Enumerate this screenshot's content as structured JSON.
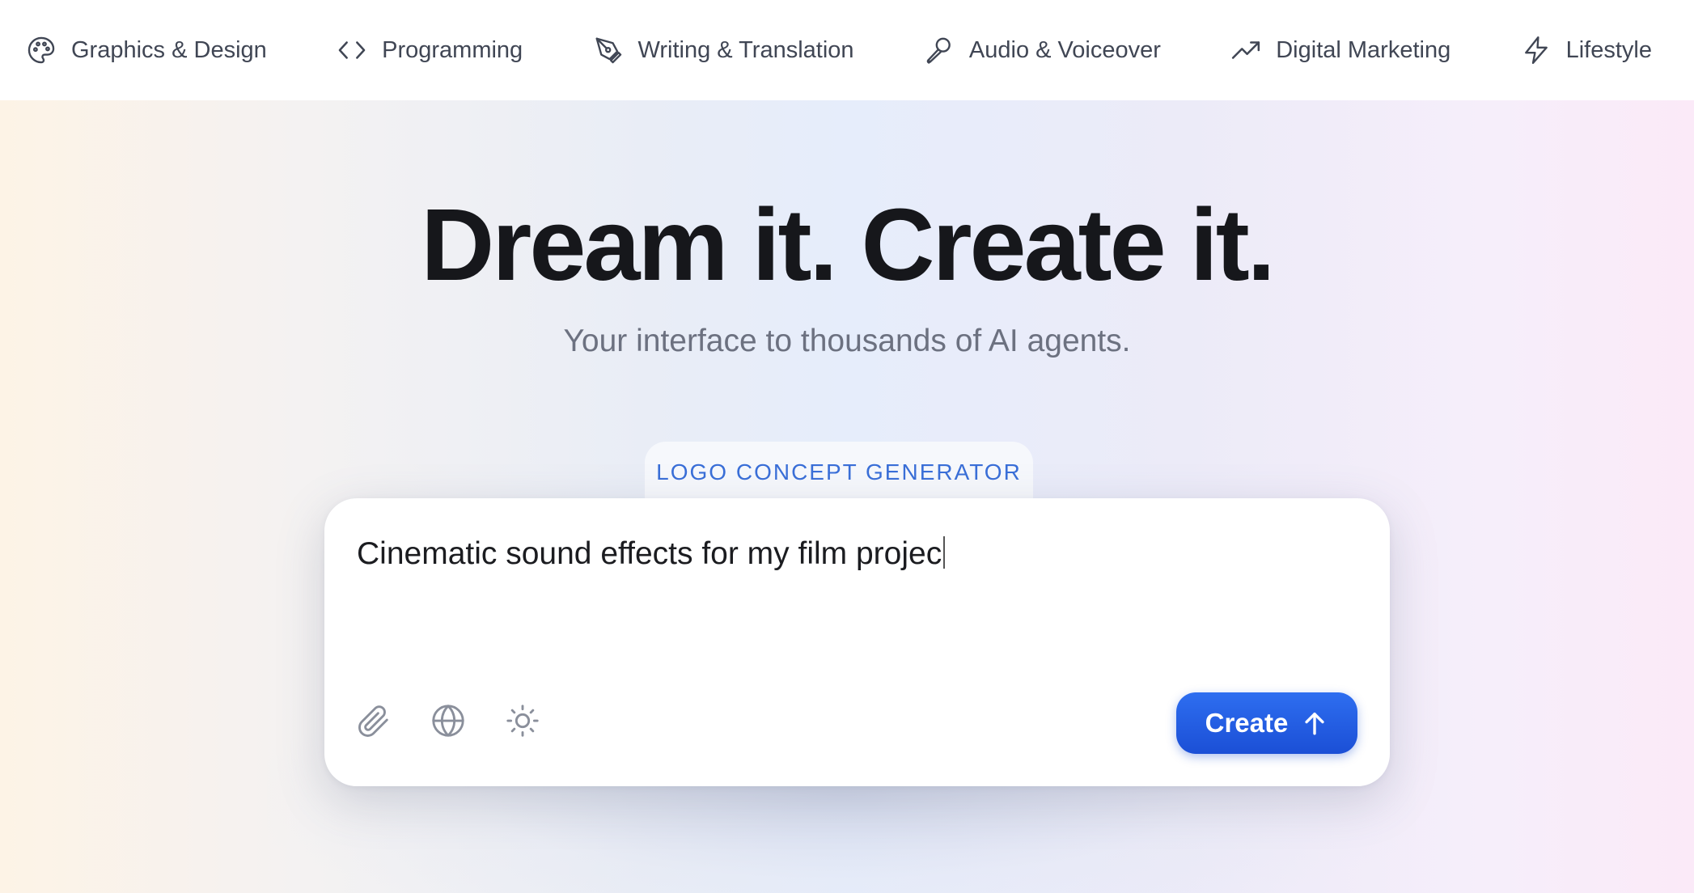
{
  "nav": {
    "categories": [
      {
        "label": "Graphics & Design",
        "icon": "palette-icon"
      },
      {
        "label": "Programming",
        "icon": "code-icon"
      },
      {
        "label": "Writing & Translation",
        "icon": "pen-tool-icon"
      },
      {
        "label": "Audio & Voiceover",
        "icon": "microphone-icon"
      },
      {
        "label": "Digital Marketing",
        "icon": "trending-up-icon"
      },
      {
        "label": "Lifestyle",
        "icon": "lightning-icon"
      }
    ]
  },
  "hero": {
    "headline": "Dream it. Create it.",
    "subheadline": "Your interface to thousands of AI agents."
  },
  "prompt_card": {
    "tag": "LOGO CONCEPT GENERATOR",
    "input_text": "Cinematic sound effects for my film projec",
    "tools": [
      "paperclip-icon",
      "globe-icon",
      "sun-icon"
    ],
    "create_label": "Create"
  },
  "colors": {
    "accent": "#1f56e0",
    "tag_text": "#3a6fd8",
    "headline": "#16171b",
    "subheadline": "#6c7180",
    "nav_text": "#404654"
  }
}
